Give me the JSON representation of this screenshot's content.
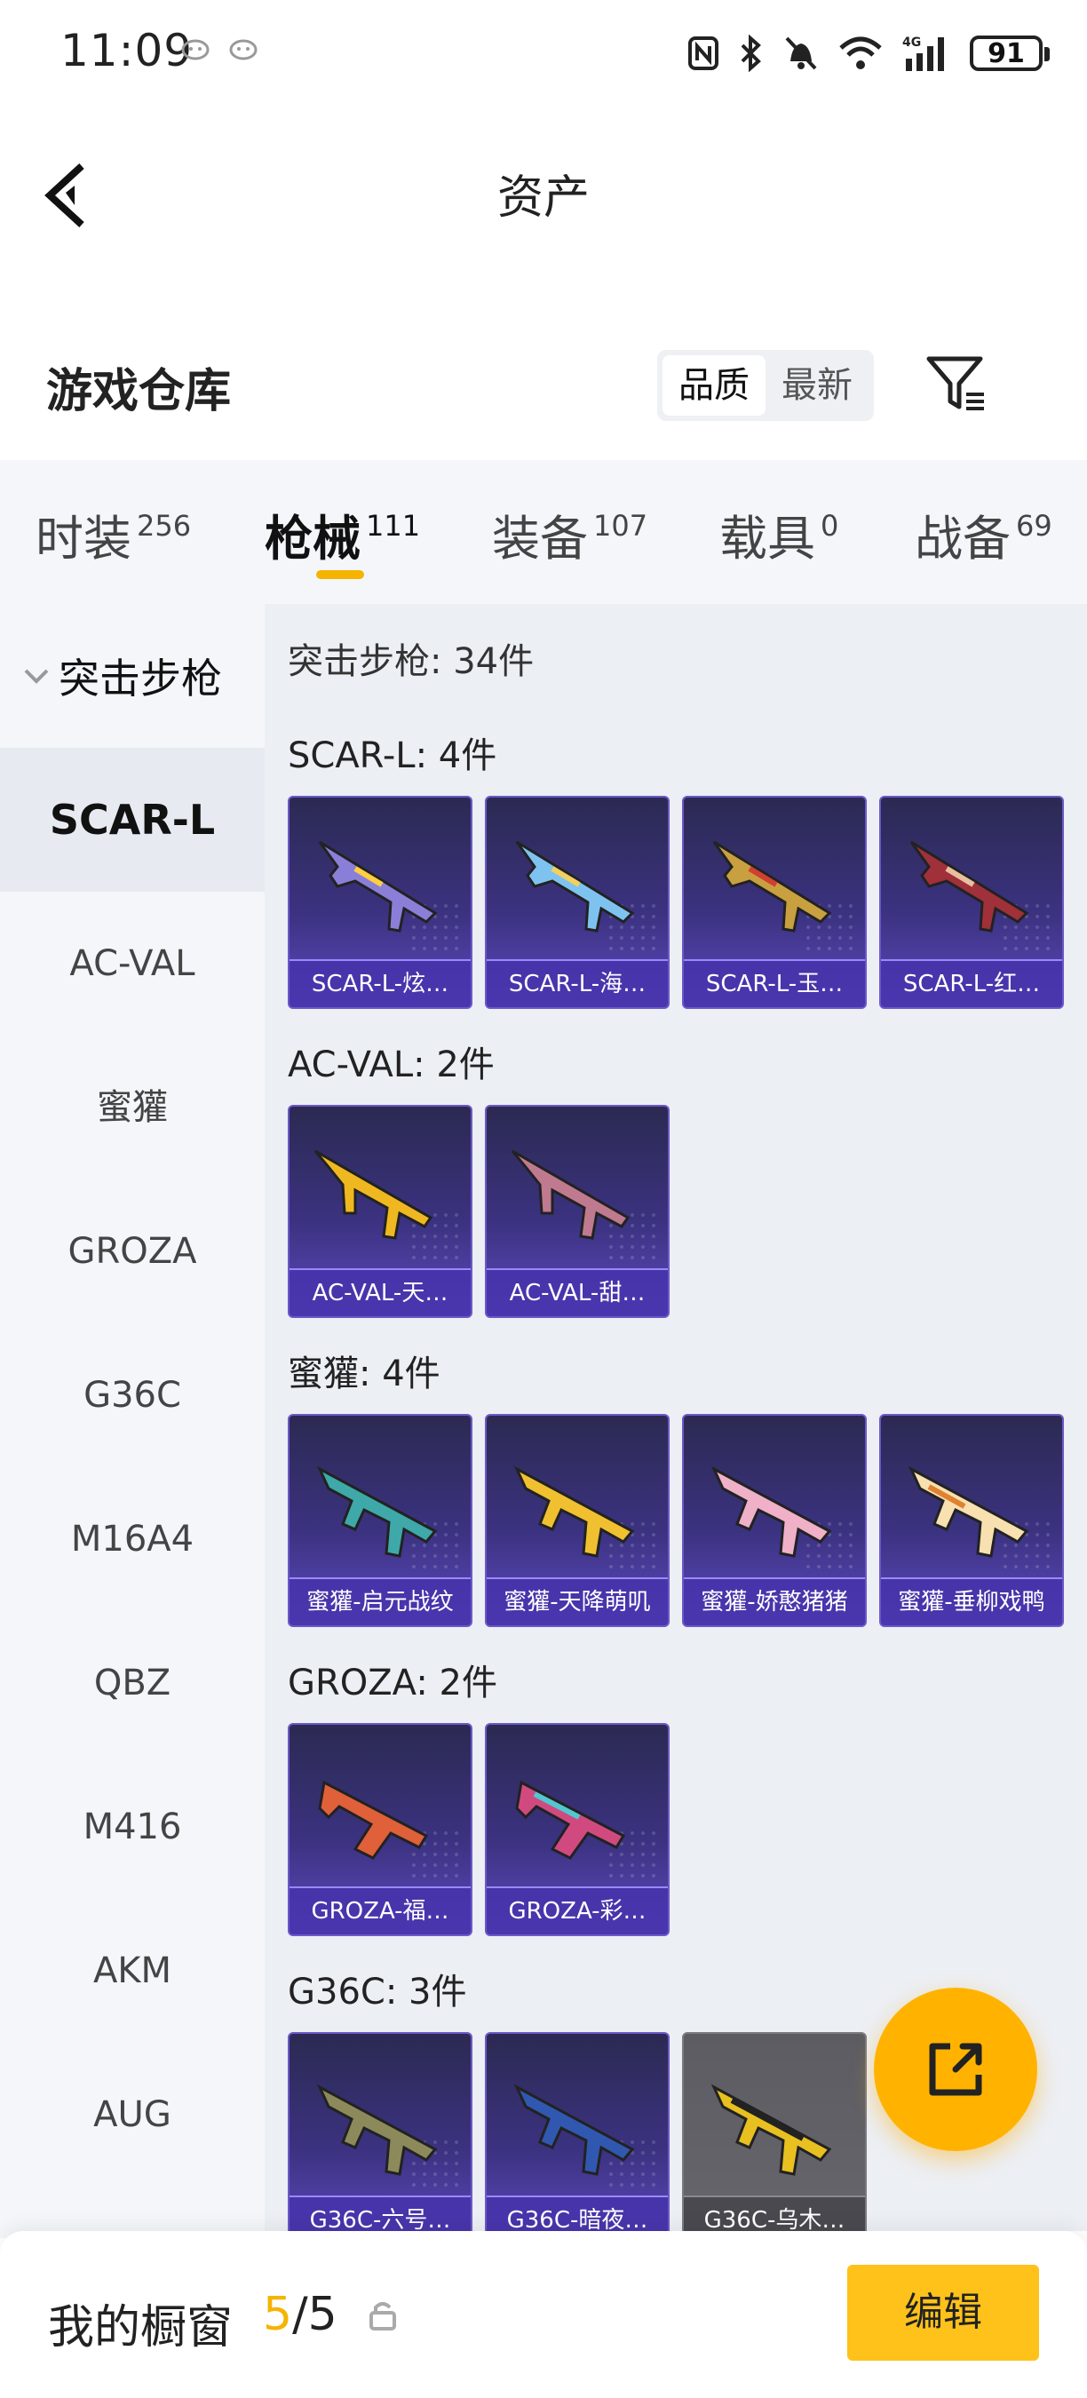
{
  "status_bar": {
    "time": "11:09",
    "battery": "91",
    "network": "4G"
  },
  "header": {
    "title": "资产"
  },
  "warehouse": {
    "title": "游戏仓库",
    "sort_options": [
      {
        "label": "品质",
        "active": true
      },
      {
        "label": "最新",
        "active": false
      }
    ]
  },
  "tabs": [
    {
      "label": "时装",
      "count": "256"
    },
    {
      "label": "枪械",
      "count": "111"
    },
    {
      "label": "装备",
      "count": "107"
    },
    {
      "label": "载具",
      "count": "0"
    },
    {
      "label": "战备",
      "count": "69"
    }
  ],
  "active_tab": 1,
  "sidebar": {
    "category": "突击步枪",
    "items": [
      "SCAR-L",
      "AC-VAL",
      "蜜獾",
      "GROZA",
      "G36C",
      "M16A4",
      "QBZ",
      "M416",
      "AKM",
      "AUG"
    ],
    "active_index": 0
  },
  "content": {
    "heading": "突击步枪: 34件",
    "groups": [
      {
        "title": "SCAR-L: 4件",
        "items": [
          "SCAR-L-炫…",
          "SCAR-L-海…",
          "SCAR-L-玉…",
          "SCAR-L-红…"
        ]
      },
      {
        "title": "AC-VAL: 2件",
        "items": [
          "AC-VAL-天…",
          "AC-VAL-甜…"
        ]
      },
      {
        "title": "蜜獾: 4件",
        "items": [
          "蜜獾-启元战纹",
          "蜜獾-天降萌叽",
          "蜜獾-娇憨猪猪",
          "蜜獾-垂柳戏鸭"
        ]
      },
      {
        "title": "GROZA: 2件",
        "items": [
          "GROZA-福…",
          "GROZA-彩…"
        ]
      },
      {
        "title": "G36C: 3件",
        "items": [
          "G36C-六号…",
          "G36C-暗夜…",
          "G36C-乌木…"
        ]
      }
    ]
  },
  "bottom_bar": {
    "label": "我的橱窗",
    "current": "5",
    "separator": "/",
    "total": "5",
    "edit_label": "编辑"
  },
  "colors": {
    "accent": "#f5b400",
    "card_purple": "#3b3280",
    "card_gray": "#5c5c62"
  }
}
